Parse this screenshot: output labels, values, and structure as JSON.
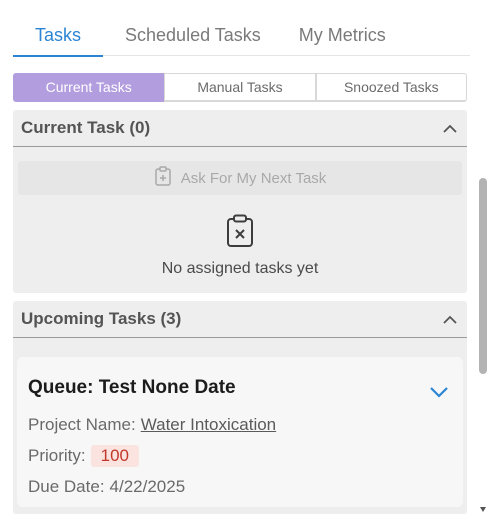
{
  "top_tabs": [
    {
      "label": "Tasks",
      "active": true
    },
    {
      "label": "Scheduled Tasks",
      "active": false
    },
    {
      "label": "My Metrics",
      "active": false
    }
  ],
  "sub_tabs": [
    {
      "label": "Current Tasks",
      "active": true
    },
    {
      "label": "Manual Tasks",
      "active": false
    },
    {
      "label": "Snoozed Tasks",
      "active": false
    }
  ],
  "current_task": {
    "title": "Current Task (0)",
    "ask_button_label": "Ask For My Next Task",
    "empty_text": "No assigned tasks yet"
  },
  "upcoming_tasks": {
    "title": "Upcoming Tasks (3)",
    "cards": [
      {
        "queue": "Queue: Test None Date",
        "project_label": "Project Name:",
        "project_value": "Water Intoxication",
        "priority_label": "Priority:",
        "priority_value": "100",
        "due_label": "Due Date:",
        "due_value": "4/22/2025"
      }
    ]
  },
  "colors": {
    "accent_blue": "#2b85d3",
    "sub_tab_active": "#b29ddf",
    "priority_bg": "#fbe3df",
    "priority_text": "#c0392b"
  },
  "icons": {
    "collapse": "chevron-up-icon",
    "expand": "chevron-down-icon",
    "ask": "clipboard-plus-icon",
    "empty": "clipboard-x-icon"
  }
}
